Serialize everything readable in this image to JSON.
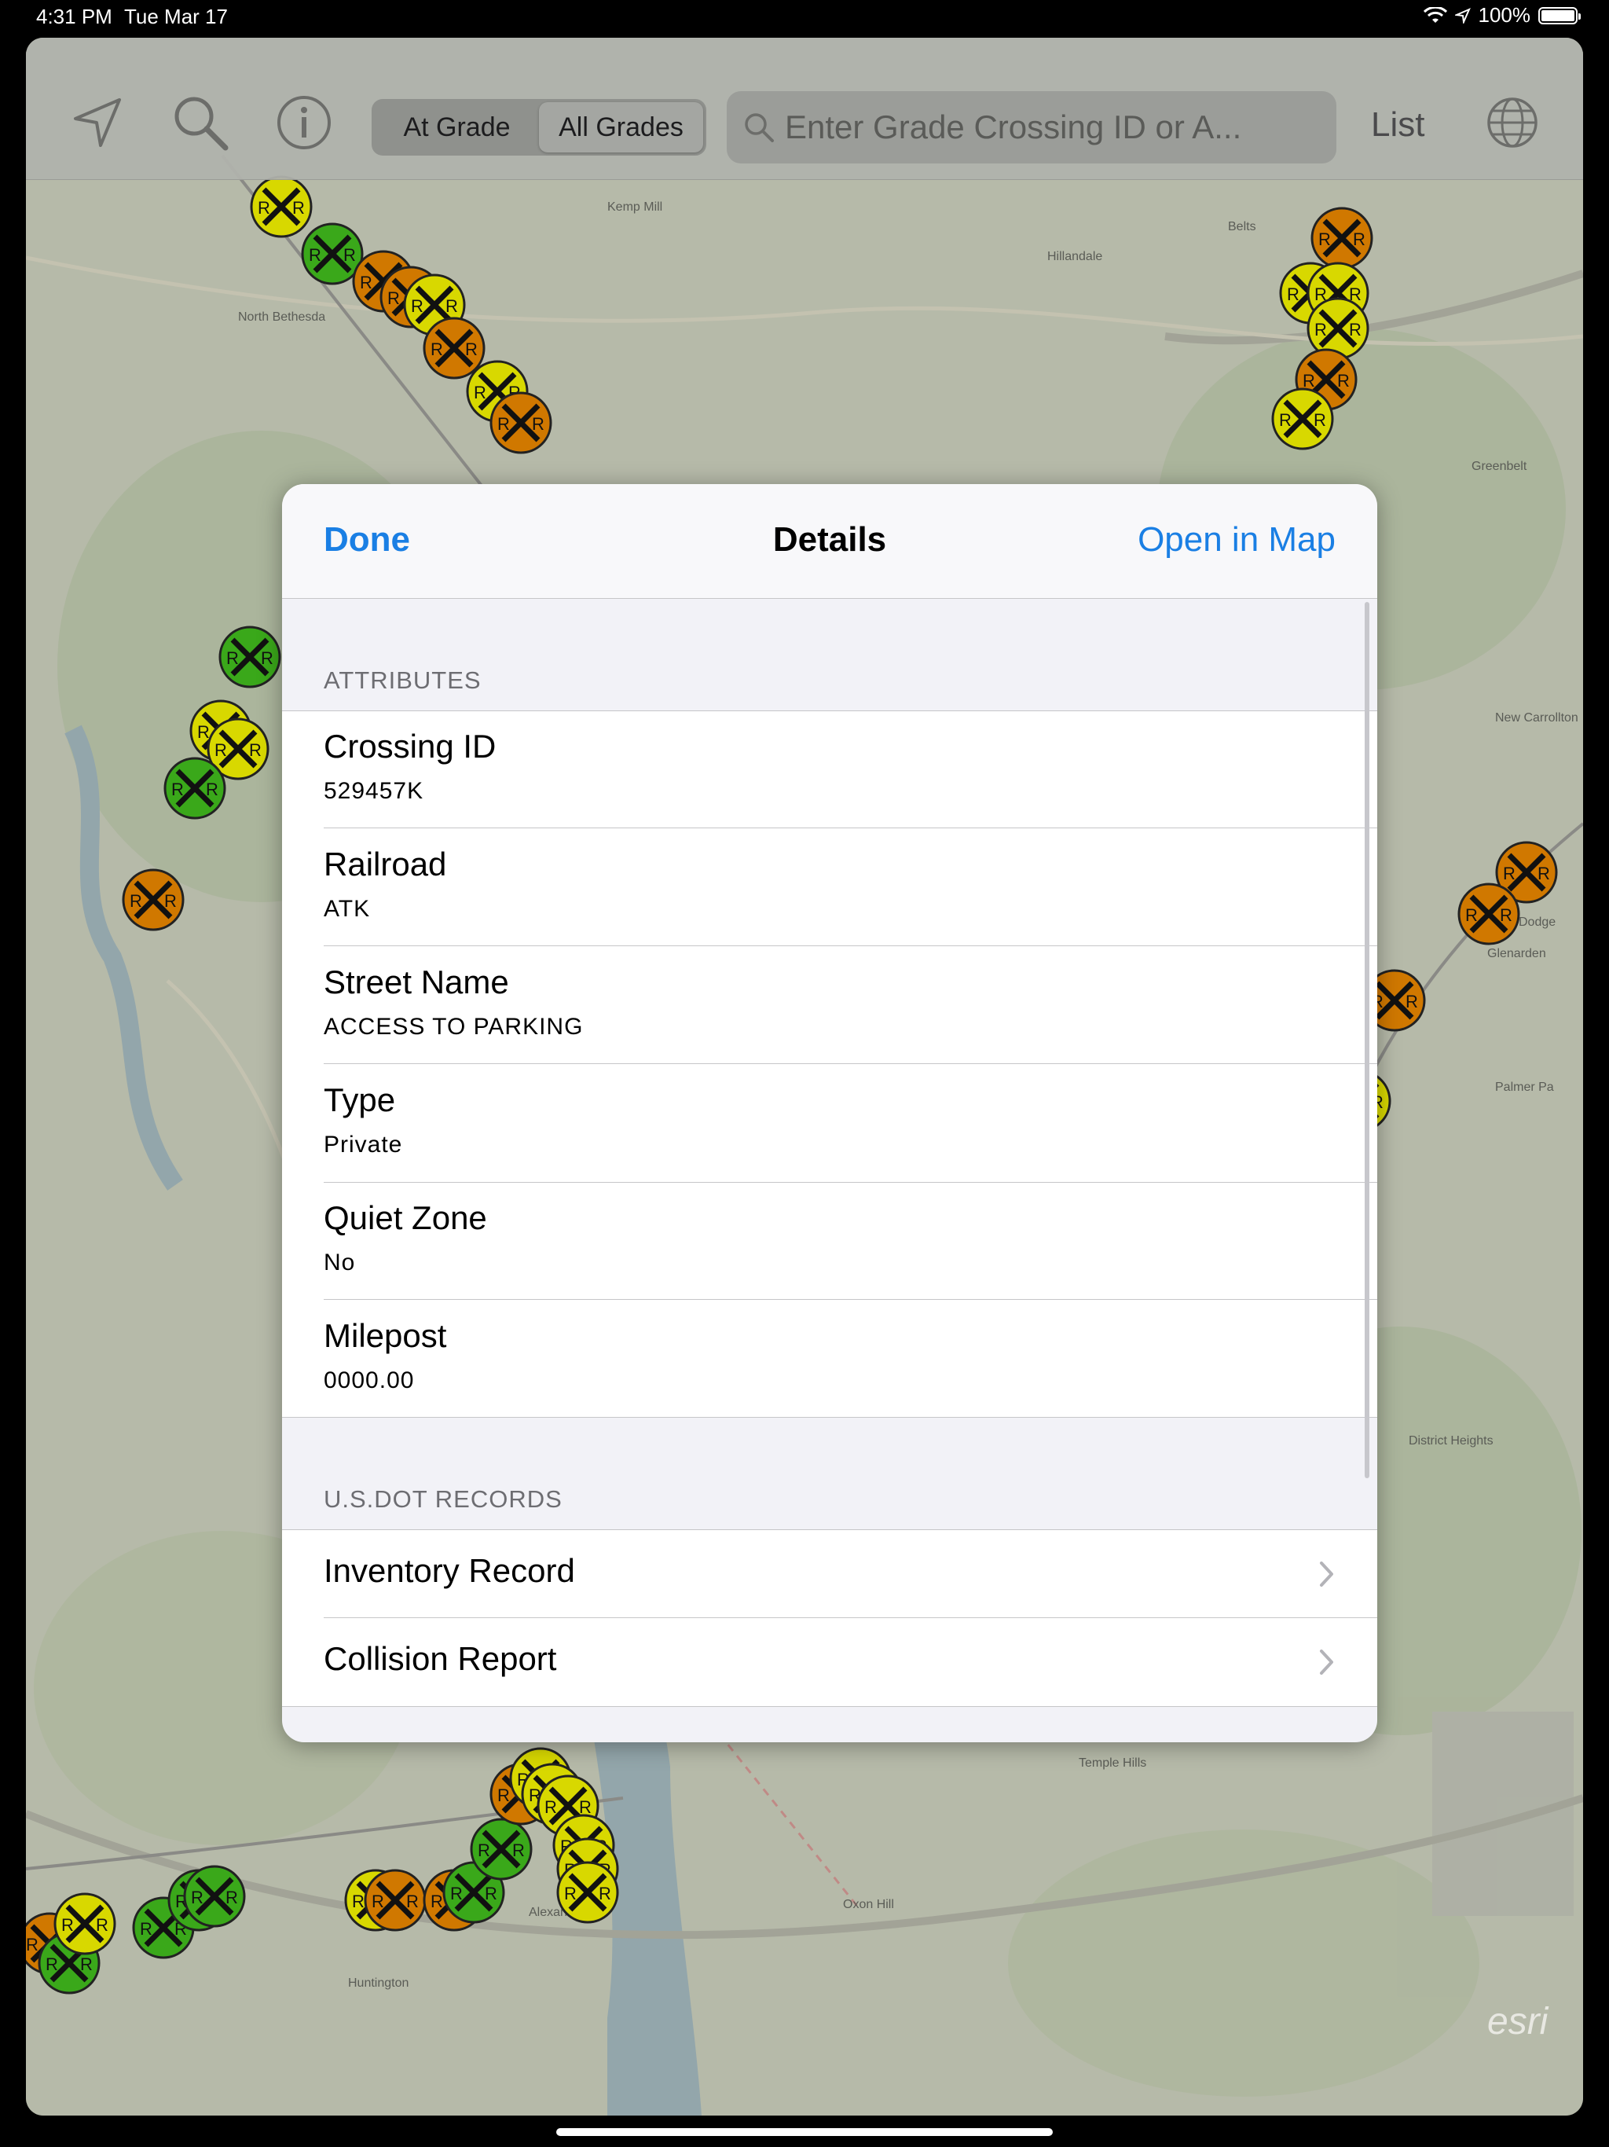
{
  "status_bar": {
    "time": "4:31 PM",
    "date": "Tue Mar 17",
    "battery": "100%",
    "icons": [
      "wifi-icon",
      "location-arrow-icon",
      "battery-icon"
    ]
  },
  "toolbar": {
    "icons": [
      "location-arrow-icon",
      "search-icon",
      "info-icon",
      "globe-icon"
    ],
    "segments": [
      "At Grade",
      "All Grades"
    ],
    "selected_segment": "All Grades",
    "search_placeholder": "Enter Grade Crossing ID or A...",
    "list_label": "List"
  },
  "map": {
    "labels": [
      "Kemp Mill",
      "Hillandale",
      "North Bethesda",
      "Greenbelt",
      "Belts",
      "New Carrollton",
      "Glenarden",
      "Dodge",
      "Palmer Pa",
      "Alexandria",
      "Huntington",
      "Oxon Hill",
      "Temple Hills",
      "District Heights",
      "esri"
    ]
  },
  "details": {
    "done_label": "Done",
    "title": "Details",
    "open_in_map_label": "Open in Map",
    "attributes_header": "ATTRIBUTES",
    "attributes": [
      {
        "label": "Crossing ID",
        "value": "529457K"
      },
      {
        "label": "Railroad",
        "value": "ATK"
      },
      {
        "label": "Street Name",
        "value": "ACCESS TO PARKING"
      },
      {
        "label": "Type",
        "value": "Private"
      },
      {
        "label": "Quiet Zone",
        "value": "No"
      },
      {
        "label": "Milepost",
        "value": "0000.00"
      }
    ],
    "records_header": "U.S.DOT RECORDS",
    "records": [
      {
        "label": "Inventory Record"
      },
      {
        "label": "Collision Report"
      }
    ]
  },
  "colors": {
    "accent": "#1a7fe4",
    "marker_yellow": "#d8d800",
    "marker_orange": "#d07800",
    "marker_green": "#3aa81a"
  }
}
